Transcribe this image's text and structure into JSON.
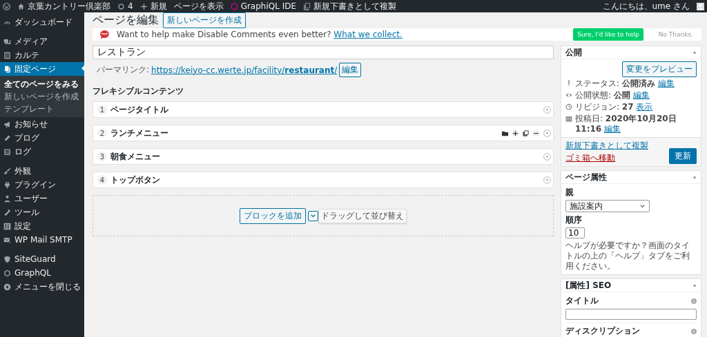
{
  "admin_bar": {
    "site_name": "京葉カントリー倶楽部",
    "updates": "4",
    "new": "新規",
    "view": "ページを表示",
    "graphiql": "GraphiQL IDE",
    "duplicate": "新規下書きとして複製",
    "greeting": "こんにちは、ume さん"
  },
  "sidebar": {
    "groups": [
      [
        {
          "label": "ダッシュボード",
          "selected": false
        }
      ],
      [
        {
          "label": "メディア",
          "selected": false
        },
        {
          "label": "カルテ",
          "selected": false
        },
        {
          "label": "固定ページ",
          "selected": true,
          "children": [
            {
              "label": "全てのページをみる",
              "selected": true
            },
            {
              "label": "新しいページを作成",
              "selected": false
            },
            {
              "label": "テンプレート",
              "selected": false
            }
          ]
        },
        {
          "label": "お知らせ",
          "selected": false
        },
        {
          "label": "ブログ",
          "selected": false
        },
        {
          "label": "ログ",
          "selected": false
        }
      ],
      [
        {
          "label": "外観",
          "selected": false
        },
        {
          "label": "プラグイン",
          "selected": false
        },
        {
          "label": "ユーザー",
          "selected": false
        },
        {
          "label": "ツール",
          "selected": false
        },
        {
          "label": "設定",
          "selected": false
        },
        {
          "label": "WP Mail SMTP",
          "selected": false
        }
      ],
      [
        {
          "label": "SiteGuard",
          "selected": false
        },
        {
          "label": "GraphQL",
          "selected": false
        },
        {
          "label": "メニューを閉じる",
          "selected": false
        }
      ]
    ]
  },
  "heading": "ページを編集",
  "add_new": "新しいページを作成",
  "notice": {
    "text": "Want to help make Disable Comments even better?",
    "link": "What we collect.",
    "accept": "Sure, I'd like to help",
    "decline": "No Thanks."
  },
  "title_field": {
    "value": "レストラン"
  },
  "permalink": {
    "label": "パーマリンク:",
    "url": "https://keiyo-cc.werte.jp/facility/**restaurant**/",
    "edit": "編集"
  },
  "flexible": {
    "label": "フレキシブルコンテンツ",
    "layouts": [
      {
        "number": "1",
        "title": "ページタイトル",
        "show_actions": false
      },
      {
        "number": "2",
        "title": "ランチメニュー",
        "show_actions": true
      },
      {
        "number": "3",
        "title": "朝食メニュー",
        "show_actions": false
      },
      {
        "number": "4",
        "title": "トップボタン",
        "show_actions": false
      }
    ],
    "add_block": "ブロックを追加",
    "tooltip": "ドラッグして並び替え"
  },
  "publish": {
    "title": "公開",
    "preview": "変更をプレビュー",
    "rows": [
      {
        "label": "ステータス:",
        "value": "公開済み",
        "link": "編集"
      },
      {
        "label": "公開状態:",
        "value": "公開",
        "link": "編集"
      },
      {
        "label": "リビジョン:",
        "value": "27",
        "link": "表示"
      },
      {
        "label": "投稿日:",
        "value": "2020年10月20日 11:16",
        "link": "編集"
      }
    ],
    "duplicate": "新規下書きとして複製",
    "trash": "ゴミ箱へ移動",
    "update": "更新"
  },
  "page_attributes": {
    "title": "ページ属性",
    "parent_label": "親",
    "parent_value": "施設案内",
    "order_label": "順序",
    "order_value": "10",
    "help": "ヘルプが必要ですか？画面のタイトルの上の「ヘルプ」タブをご利用ください。"
  },
  "seo": {
    "title": "[属性] SEO",
    "title_label": "タイトル",
    "description_label": "ディスクリプション"
  }
}
